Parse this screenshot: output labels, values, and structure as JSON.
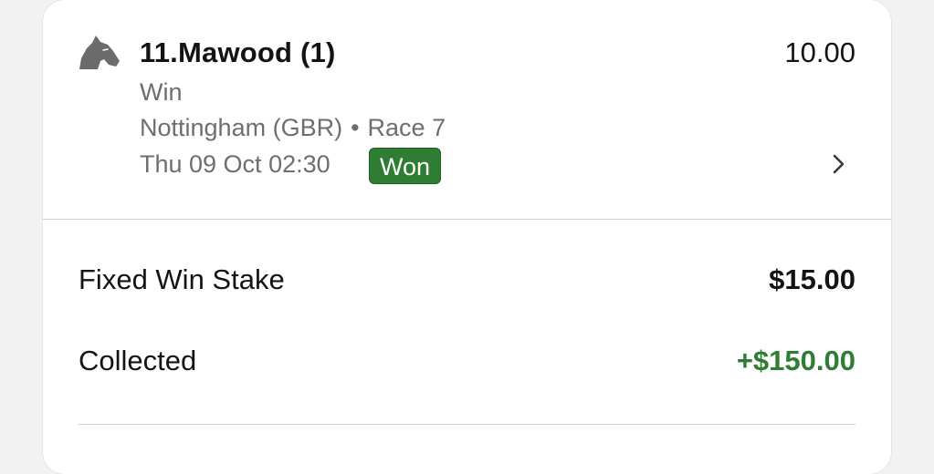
{
  "selection": {
    "runner_name": "11.Mawood (1)",
    "odds": "10.00",
    "bet_type": "Win",
    "venue": "Nottingham (GBR)",
    "separator": "•",
    "race": "Race 7",
    "datetime": "Thu 09 Oct 02:30",
    "result_badge": "Won",
    "icon": "horse-head-icon",
    "chevron_icon": "chevron-right-icon"
  },
  "summary": {
    "stake_label": "Fixed Win Stake",
    "stake_value": "$15.00",
    "collected_label": "Collected",
    "collected_value": "+$150.00"
  },
  "colors": {
    "won_badge": "#2e7d32",
    "collected_positive": "#2e7d32",
    "secondary_text": "#6e6e6e",
    "icon_gray": "#6b6b6b"
  }
}
